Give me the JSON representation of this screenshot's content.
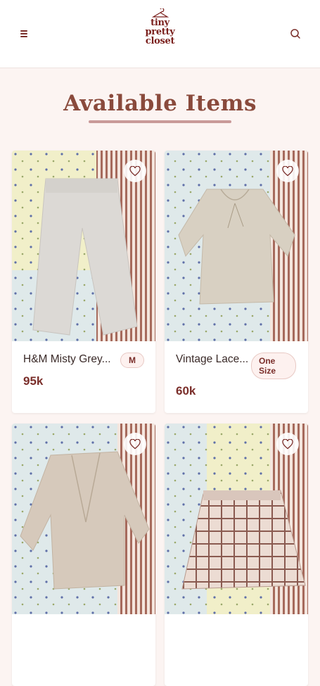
{
  "header": {
    "logo_lines": [
      "tiny",
      "pretty",
      "closet"
    ],
    "menu_icon": "hamburger-menu-icon",
    "search_icon": "search-icon"
  },
  "page_title": "Available Items",
  "colors": {
    "accent": "#7a2e2a",
    "background": "#fcf4f2",
    "badge_bg": "#fdf1ef"
  },
  "products": [
    {
      "name": "H&M Misty Grey...",
      "size": "M",
      "price": "95k",
      "fav_icon": "heart-icon",
      "image": "grey-sweatpants-photo"
    },
    {
      "name": "Vintage Lace...",
      "size": "One Size",
      "price": "60k",
      "fav_icon": "heart-icon",
      "image": "beige-lace-top-photo"
    },
    {
      "name": "",
      "size": "",
      "price": "",
      "fav_icon": "heart-icon",
      "image": "beige-cardigan-photo"
    },
    {
      "name": "",
      "size": "",
      "price": "",
      "fav_icon": "heart-icon",
      "image": "plaid-pleated-skirt-photo"
    }
  ]
}
